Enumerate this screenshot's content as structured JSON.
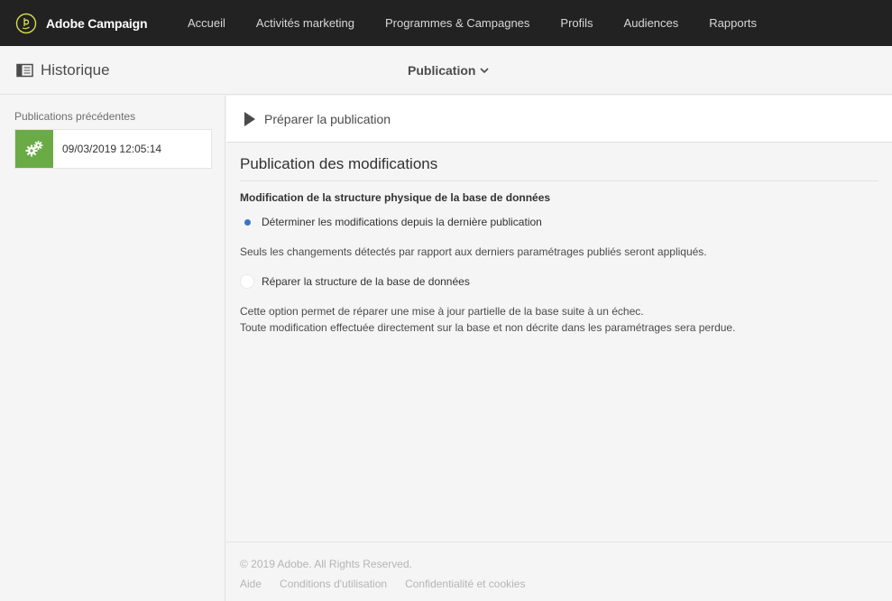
{
  "topbar": {
    "brand": "Adobe Campaign",
    "nav": [
      {
        "label": "Accueil",
        "name": "nav-accueil"
      },
      {
        "label": "Activités marketing",
        "name": "nav-activites-marketing"
      },
      {
        "label": "Programmes & Campagnes",
        "name": "nav-programmes-campagnes"
      },
      {
        "label": "Profils",
        "name": "nav-profils"
      },
      {
        "label": "Audiences",
        "name": "nav-audiences"
      },
      {
        "label": "Rapports",
        "name": "nav-rapports"
      }
    ]
  },
  "header": {
    "history_label": "Historique",
    "publication_label": "Publication"
  },
  "sidebar": {
    "title": "Publications précédentes",
    "items": [
      {
        "date": "09/03/2019 12:05:14",
        "status_color": "#6aab45"
      }
    ]
  },
  "main": {
    "prepare_label": "Préparer la publication",
    "section_title": "Publication des modifications",
    "sub_title": "Modification de la structure physique de la base de données",
    "option1_label": "Déterminer les modifications depuis la dernière publication",
    "option1_checked": true,
    "option1_desc": "Seuls les changements détectés par rapport aux derniers paramétrages publiés seront appliqués.",
    "option2_label": "Réparer la structure de la base de données",
    "option2_checked": false,
    "option2_desc_line1": "Cette option permet de réparer une mise à jour partielle de la base suite à un échec.",
    "option2_desc_line2": "Toute modification effectuée directement sur la base et non décrite dans les paramétrages sera perdue."
  },
  "footer": {
    "copyright": "© 2019 Adobe. All Rights Reserved.",
    "links": [
      "Aide",
      "Conditions d'utilisation",
      "Confidentialité et cookies"
    ]
  },
  "colors": {
    "topbar_bg": "#222222",
    "accent_blue": "#3c74c5",
    "status_green": "#6aab45"
  }
}
